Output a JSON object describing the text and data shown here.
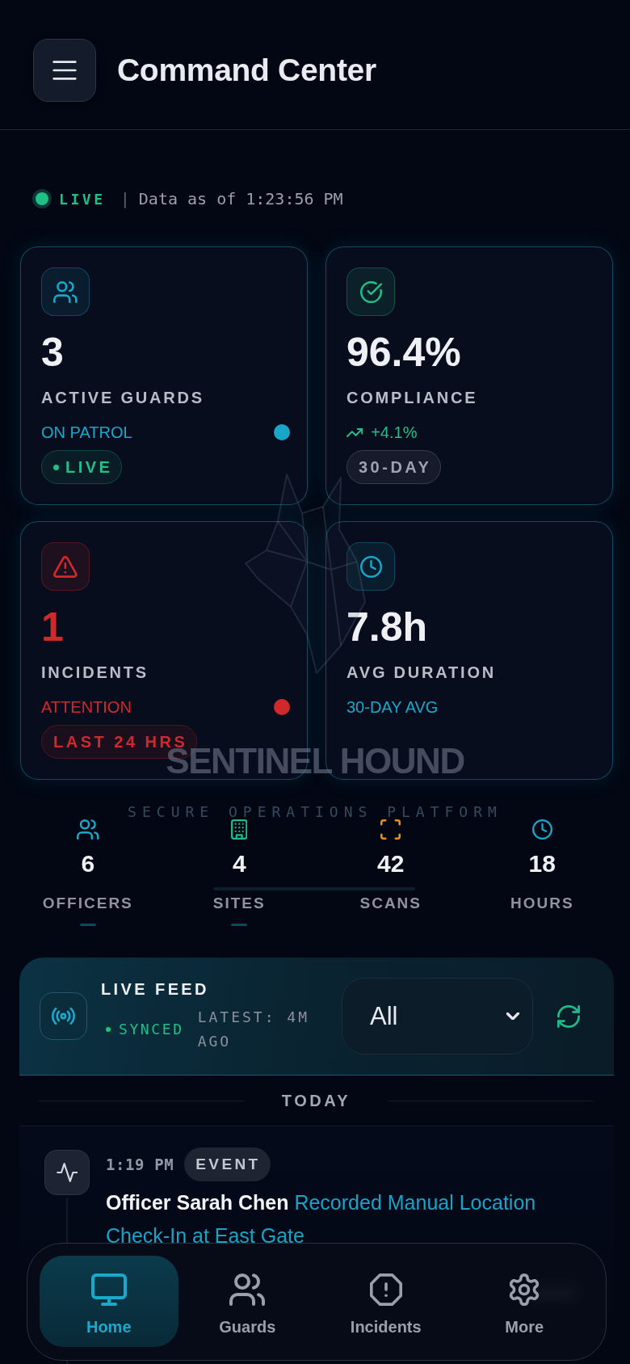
{
  "header": {
    "title": "Command Center"
  },
  "status": {
    "label": "LIVE",
    "separator": "|",
    "timestamp": "Data as of 1:23:56 PM"
  },
  "cards": [
    {
      "color": "#19a7c9",
      "value": "3",
      "alert": false,
      "label": "ACTIVE GUARDS",
      "sub": {
        "kind": "status",
        "text": "ON PATROL"
      },
      "badge": {
        "text": "LIVE",
        "color": "#22bf8a",
        "dot": true
      }
    },
    {
      "color": "#22bf8a",
      "value": "96.4%",
      "alert": false,
      "label": "COMPLIANCE",
      "sub": {
        "kind": "trend",
        "text": "+4.1%"
      },
      "badge": {
        "text": "30-DAY",
        "color": "#9ca3af",
        "dot": false
      }
    },
    {
      "color": "#d0292c",
      "value": "1",
      "alert": true,
      "label": "INCIDENTS",
      "sub": {
        "kind": "status",
        "text": "ATTENTION"
      },
      "badge": {
        "text": "LAST 24 HRS",
        "color": "#d0292c",
        "dot": false
      }
    },
    {
      "color": "#19a7c9",
      "value": "7.8h",
      "alert": false,
      "label": "AVG DURATION",
      "sub": {
        "kind": "plain",
        "text": "30-DAY AVG"
      }
    }
  ],
  "watermark": {
    "title": "SENTINEL HOUND",
    "tagline": "SECURE OPERATIONS PLATFORM"
  },
  "stats": [
    {
      "color": "#19a7c9",
      "value": "6",
      "label": "OFFICERS",
      "highlighted": true
    },
    {
      "color": "#1fb98a",
      "value": "4",
      "label": "SITES",
      "highlighted": true
    },
    {
      "color": "#e3951c",
      "value": "42",
      "label": "SCANS",
      "highlighted": false
    },
    {
      "color": "#19a7c9",
      "value": "18",
      "label": "HOURS",
      "highlighted": false
    }
  ],
  "live_feed": {
    "title": "LIVE FEED",
    "status": "SYNCED",
    "latest": "LATEST: 4M AGO",
    "filter": "All"
  },
  "feed": {
    "section": "TODAY",
    "items": [
      {
        "time": "1:19 PM",
        "tag": "EVENT",
        "text": "**Officer Sarah Chen** Recorded Manual Location Check-In at East Gate"
      }
    ]
  },
  "nav": [
    {
      "label": "Home",
      "selected": true
    },
    {
      "label": "Guards",
      "selected": false
    },
    {
      "label": "Incidents",
      "selected": false
    },
    {
      "label": "More",
      "selected": false
    }
  ]
}
